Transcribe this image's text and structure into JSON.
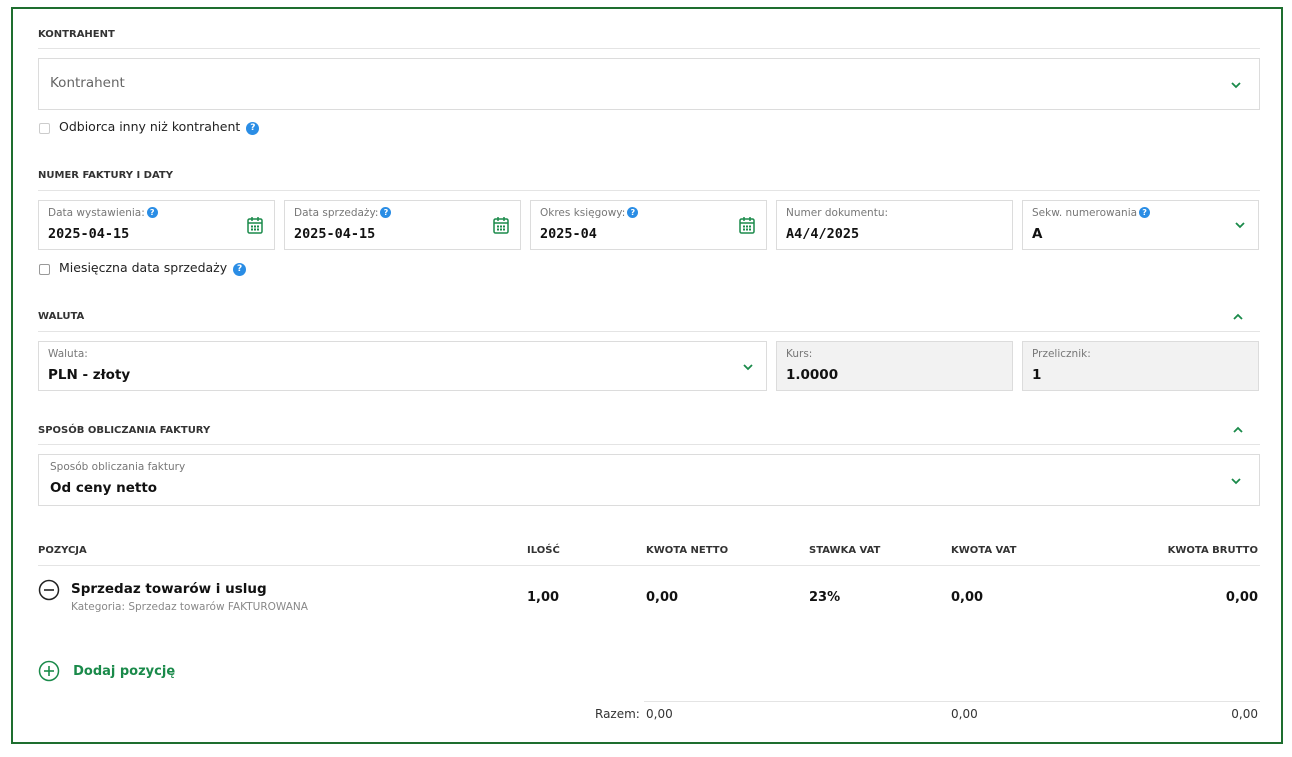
{
  "kontrahent": {
    "section_title": "KONTRAHENT",
    "select_placeholder": "Kontrahent",
    "other_recipient_label": "Odbiorca inny niż kontrahent"
  },
  "numbering": {
    "section_title": "NUMER FAKTURY I DATY",
    "issue_date": {
      "label": "Data wystawienia:",
      "value": "2025-04-15"
    },
    "sale_date": {
      "label": "Data sprzedaży:",
      "value": "2025-04-15"
    },
    "accounting_period": {
      "label": "Okres księgowy:",
      "value": "2025-04"
    },
    "document_number": {
      "label": "Numer dokumentu:",
      "value": "A4/4/2025"
    },
    "numbering_sequence": {
      "label": "Sekw. numerowania",
      "value": "A"
    },
    "monthly_sale_date_label": "Miesięczna data sprzedaży"
  },
  "currency": {
    "section_title": "WALUTA",
    "currency_field": {
      "label": "Waluta:",
      "value": "PLN - złoty"
    },
    "rate_field": {
      "label": "Kurs:",
      "value": "1.0000"
    },
    "converter_field": {
      "label": "Przelicznik:",
      "value": "1"
    }
  },
  "calculation": {
    "section_title": "SPOSÓB OBLICZANIA FAKTURY",
    "method_field": {
      "label": "Sposób obliczania faktury",
      "value": "Od ceny netto"
    }
  },
  "items": {
    "headers": {
      "position": "POZYCJA",
      "quantity": "ILOŚĆ",
      "net_amount": "KWOTA NETTO",
      "vat_rate": "STAWKA VAT",
      "vat_amount": "KWOTA VAT",
      "gross_amount": "KWOTA BRUTTO"
    },
    "rows": [
      {
        "name": "Sprzedaz towarów i uslug",
        "category": "Kategoria: Sprzedaz towarów FAKTUROWANA",
        "quantity": "1,00",
        "net": "0,00",
        "vat_rate": "23%",
        "vat": "0,00",
        "gross": "0,00"
      }
    ],
    "add_label": "Dodaj pozycję",
    "totals": {
      "label": "Razem:",
      "net": "0,00",
      "vat": "0,00",
      "gross": "0,00"
    }
  },
  "colors": {
    "accent": "#1a8a4a",
    "frame": "#1e6e2f",
    "help": "#2a8de5"
  }
}
